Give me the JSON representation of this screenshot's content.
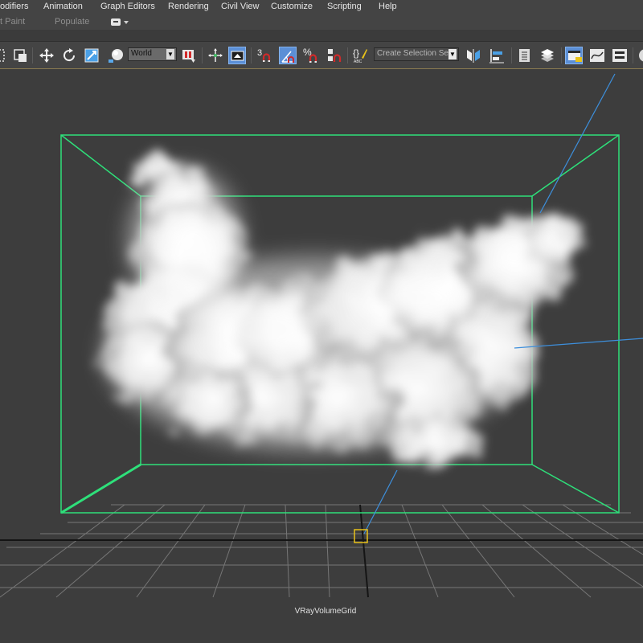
{
  "menu": {
    "items": [
      "odifiers",
      "Animation",
      "Graph Editors",
      "Rendering",
      "Civil View",
      "Customize",
      "Scripting",
      "Help"
    ]
  },
  "ribbon": {
    "tabs": [
      "t Paint",
      "Populate"
    ]
  },
  "toolbar": {
    "reference_coord": "World",
    "selection_set_placeholder": "Create Selection Se",
    "snap_3d_label": "3",
    "percent_snap_label": "%"
  },
  "viewport": {
    "object_label": "VRayVolumeGrid",
    "bbox_color": "#2ee07a",
    "link_color": "#3d8fdc",
    "pivot_color": "#e8c21a"
  }
}
